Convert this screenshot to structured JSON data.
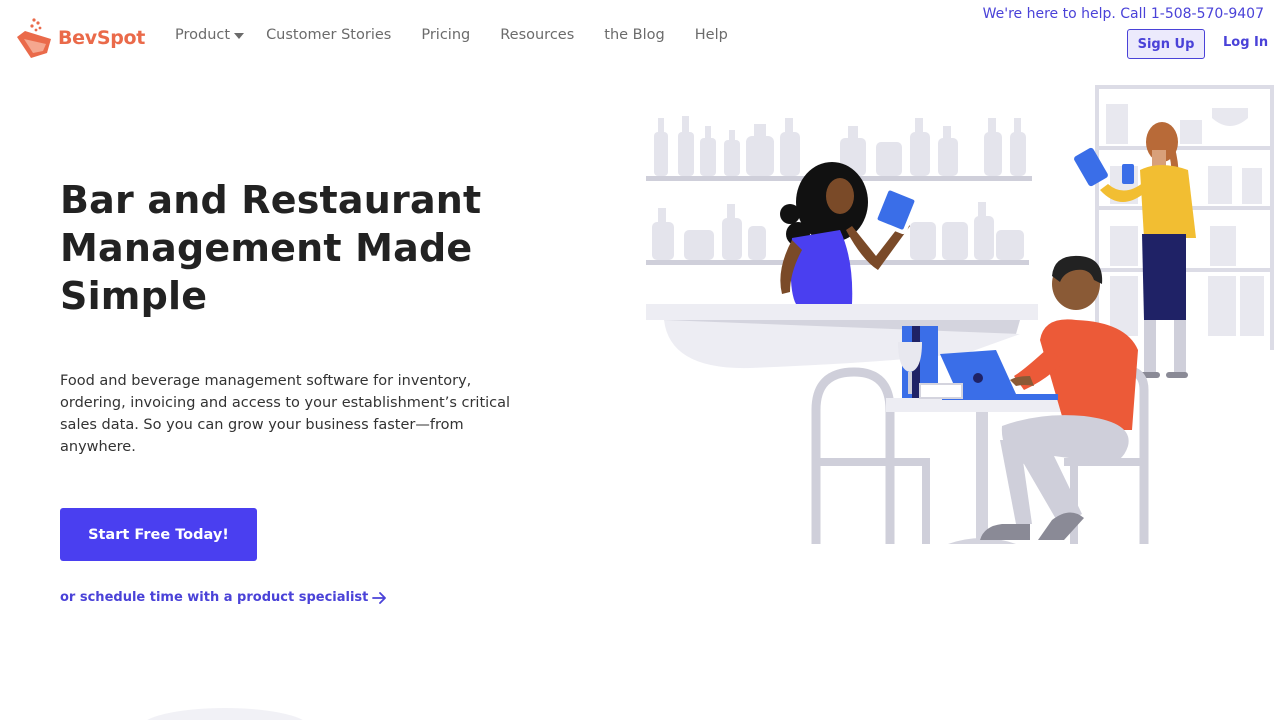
{
  "brand": {
    "name": "BevSpot",
    "color": "#ea6a4a"
  },
  "nav": {
    "items": [
      {
        "label": "Product",
        "has_dropdown": true
      },
      {
        "label": "Customer Stories"
      },
      {
        "label": "Pricing"
      },
      {
        "label": "Resources"
      },
      {
        "label": "the Blog"
      },
      {
        "label": "Help"
      }
    ]
  },
  "header": {
    "help_text": "We're here to help. Call ",
    "phone": "1-508-570-9407",
    "signup_label": "Sign Up",
    "login_label": "Log In"
  },
  "hero": {
    "title": "Bar and Restaurant Management Made Simple",
    "description": "Food and beverage management software for inventory, ordering, invoicing and access to your establishment’s critical sales data. So you can grow your business faster—from anywhere.",
    "cta_label": "Start Free Today!",
    "schedule_label": "or schedule time with a product specialist"
  },
  "colors": {
    "accent": "#4a3ff0",
    "link": "#4a42d8",
    "heading": "#222222"
  },
  "icons": [
    "bevspot-logo-icon",
    "chevron-down-icon",
    "arrow-right-icon"
  ]
}
